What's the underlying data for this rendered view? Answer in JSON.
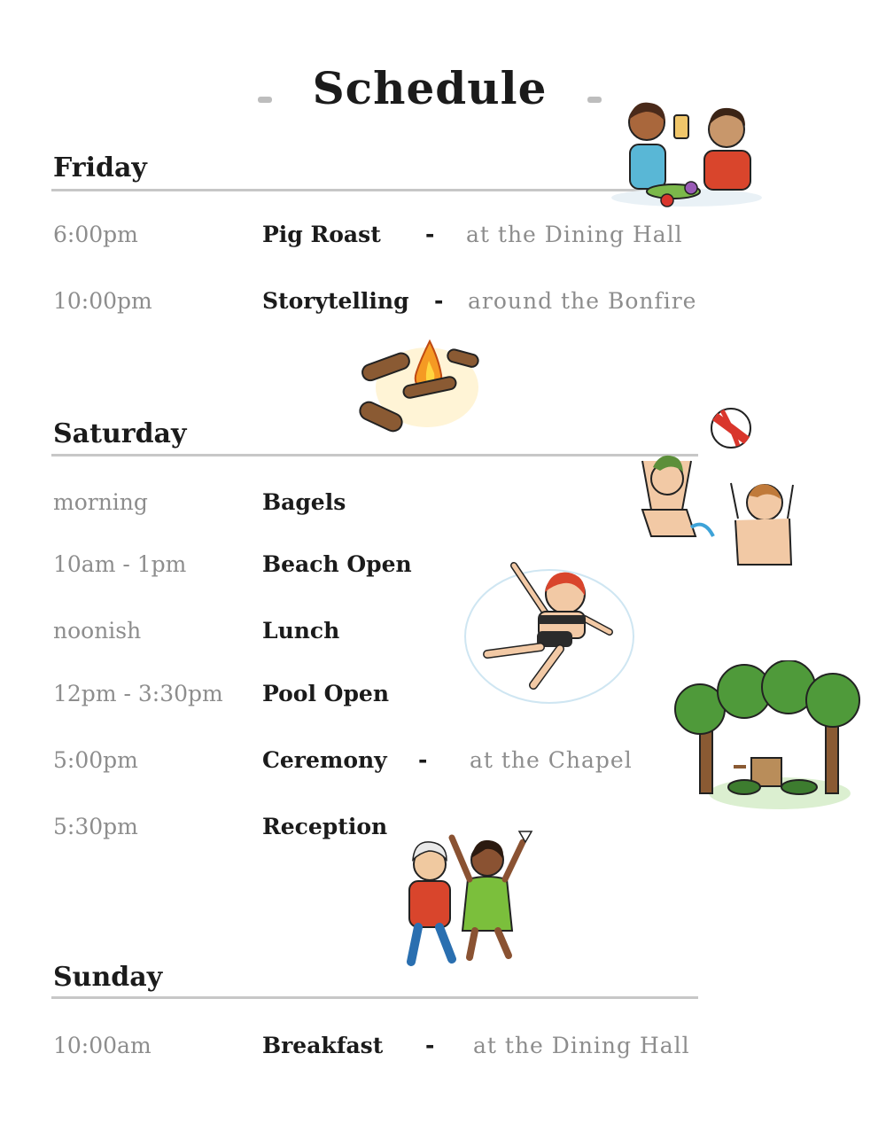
{
  "title": "Schedule",
  "days": [
    {
      "name": "Friday",
      "items": [
        {
          "time": "6:00pm",
          "event": "Pig Roast",
          "separator": "-",
          "location": "at the Dining Hall"
        },
        {
          "time": "10:00pm",
          "event": "Storytelling",
          "separator": "-",
          "location": "around the Bonfire"
        }
      ]
    },
    {
      "name": "Saturday",
      "items": [
        {
          "time": "morning",
          "event": "Bagels"
        },
        {
          "time": "10am - 1pm",
          "event": "Beach Open"
        },
        {
          "time": "noonish",
          "event": "Lunch"
        },
        {
          "time": "12pm - 3:30pm",
          "event": "Pool Open"
        },
        {
          "time": "5:00pm",
          "event": "Ceremony",
          "separator": "-",
          "location": "at the Chapel"
        },
        {
          "time": "5:30pm",
          "event": "Reception"
        }
      ]
    },
    {
      "name": "Sunday",
      "items": [
        {
          "time": "10:00am",
          "event": "Breakfast",
          "separator": "-",
          "location": "at the Dining Hall"
        }
      ]
    }
  ],
  "colors": {
    "ink": "#1b1b1b",
    "muted": "#8d8d8d",
    "rule": "#c7c7c7"
  },
  "illustrations": [
    "couple-feast-illustration",
    "bonfire-illustration",
    "beach-ball-swimmers-illustration",
    "floating-swimmer-illustration",
    "chapel-trees-illustration",
    "dancing-couple-illustration"
  ]
}
